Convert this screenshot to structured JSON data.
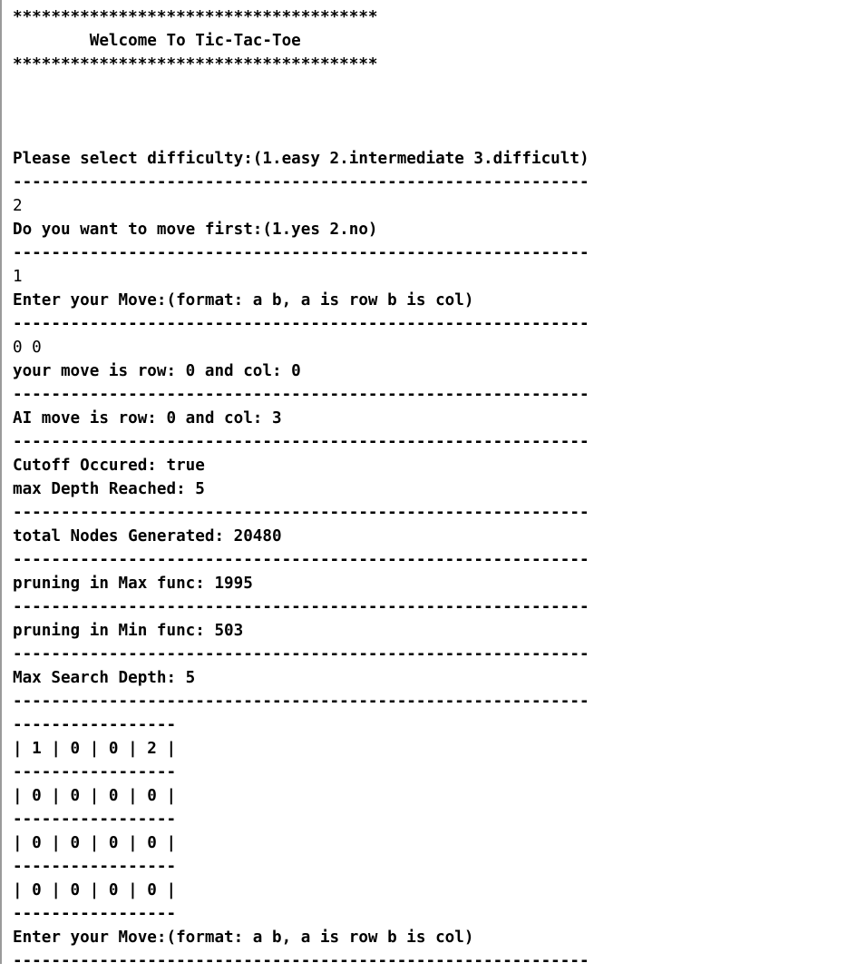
{
  "terminal": {
    "background_color": "#ffffff",
    "text_color": "#000000",
    "border_color": "#9a9a9a"
  },
  "banner": {
    "top_rule": "**************************************",
    "title": "        Welcome To Tic-Tac-Toe",
    "bottom_rule": "**************************************"
  },
  "separators": {
    "full": "------------------------------------------------------------",
    "board": "-----------------"
  },
  "blank": "",
  "transcript": {
    "difficulty_prompt": "Please select difficulty:(1.easy 2.intermediate 3.difficult)",
    "difficulty_input": "2",
    "move_first_prompt": "Do you want to move first:(1.yes 2.no)",
    "move_first_input": "1",
    "enter_move_prompt": "Enter your Move:(format: a b, a is row b is col)",
    "move_input": "0 0",
    "your_move": "your move is row: 0 and col: 0",
    "ai_move": "AI move is row: 0 and col: 3",
    "cutoff_occured": "Cutoff Occured: true",
    "max_depth_reached": "max Depth Reached: 5",
    "total_nodes_generated": "total Nodes Generated: 20480",
    "pruning_max": "pruning in Max func: 1995",
    "pruning_min": "pruning in Min func: 503",
    "max_search_depth": "Max Search Depth: 5",
    "enter_move_prompt_2": "Enter your Move:(format: a b, a is row b is col)"
  },
  "stats": {
    "difficulty_selected": "2",
    "move_first_selected": "1",
    "player_move_row": "0",
    "player_move_col": "0",
    "ai_move_row": "0",
    "ai_move_col": "3",
    "cutoff": "true",
    "depth_reached": "5",
    "nodes_generated": "20480",
    "prune_max": "1995",
    "prune_min": "503",
    "search_depth": "5"
  },
  "board": {
    "rows": [
      "| 1 | 0 | 0 | 2 |",
      "| 0 | 0 | 0 | 0 |",
      "| 0 | 0 | 0 | 0 |",
      "| 0 | 0 | 0 | 0 |"
    ],
    "cells": [
      [
        "1",
        "0",
        "0",
        "2"
      ],
      [
        "0",
        "0",
        "0",
        "0"
      ],
      [
        "0",
        "0",
        "0",
        "0"
      ],
      [
        "0",
        "0",
        "0",
        "0"
      ]
    ]
  }
}
